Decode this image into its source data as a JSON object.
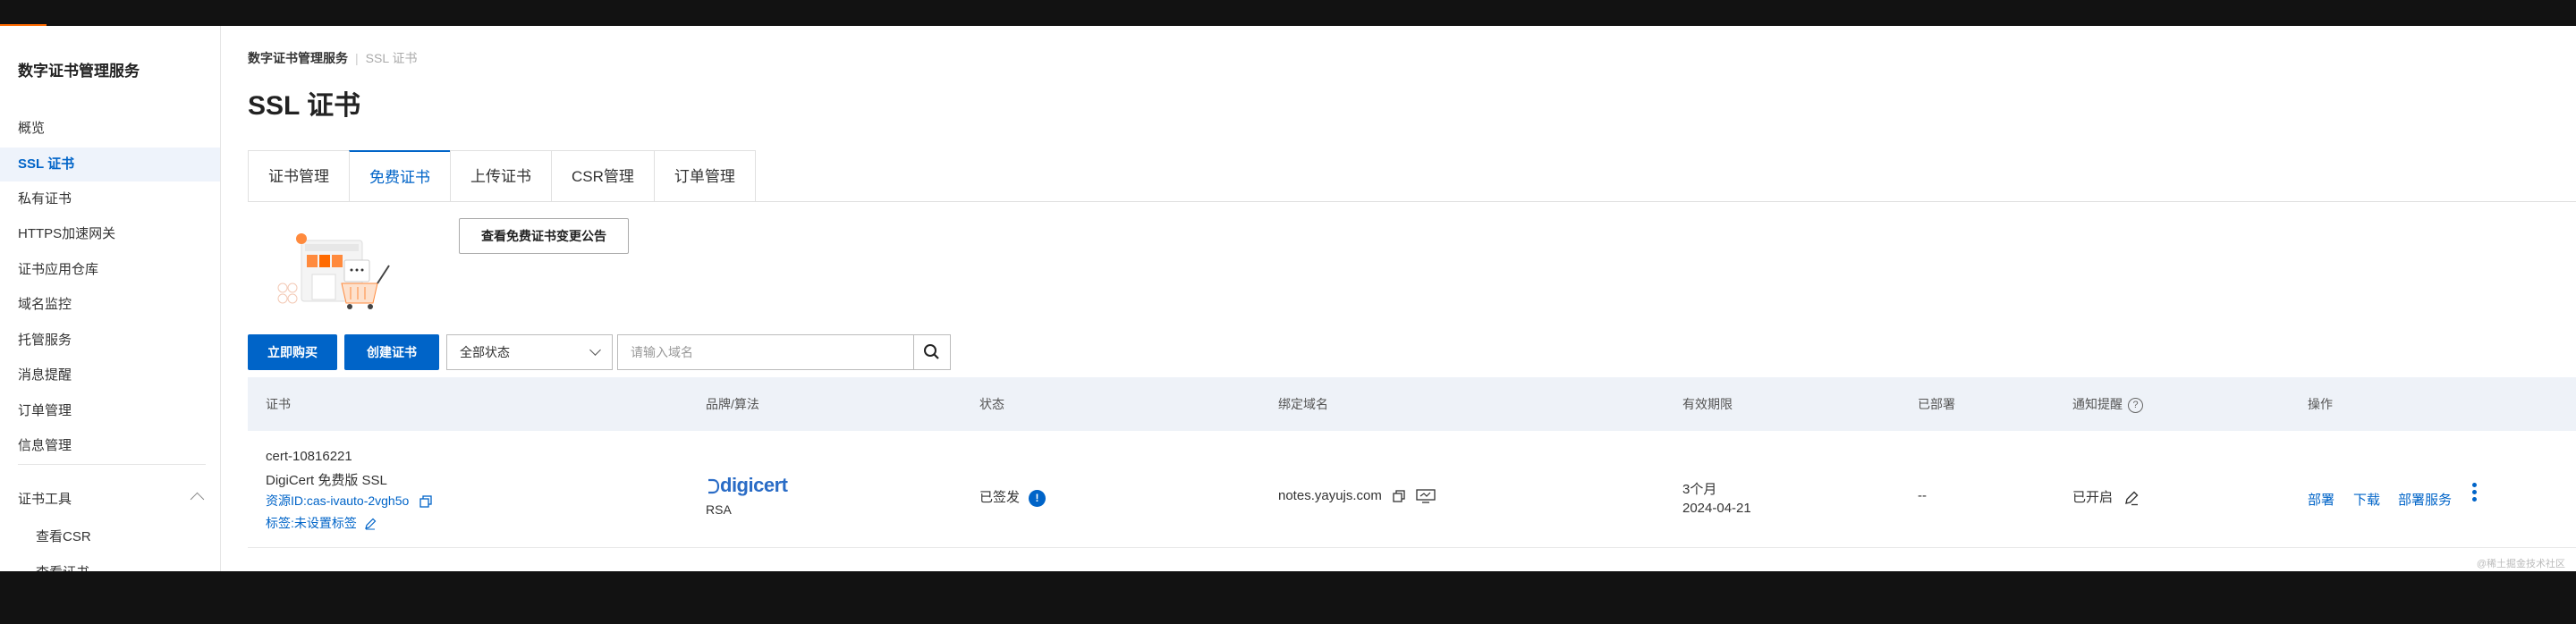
{
  "sidebar": {
    "title": "数字证书管理服务",
    "items": [
      {
        "label": "概览"
      },
      {
        "label": "SSL 证书"
      },
      {
        "label": "私有证书"
      },
      {
        "label": "HTTPS加速网关"
      },
      {
        "label": "证书应用仓库"
      },
      {
        "label": "域名监控"
      },
      {
        "label": "托管服务"
      },
      {
        "label": "消息提醒"
      },
      {
        "label": "订单管理"
      },
      {
        "label": "信息管理"
      }
    ],
    "tools_group": "证书工具",
    "tools_items": [
      {
        "label": "查看CSR"
      },
      {
        "label": "查看证书"
      }
    ]
  },
  "breadcrumb": {
    "parent": "数字证书管理服务",
    "current": "SSL 证书"
  },
  "page_title": "SSL 证书",
  "tabs": [
    {
      "label": "证书管理"
    },
    {
      "label": "免费证书"
    },
    {
      "label": "上传证书"
    },
    {
      "label": "CSR管理"
    },
    {
      "label": "订单管理"
    }
  ],
  "notice_button": "查看免费证书变更公告",
  "toolbar": {
    "buy_label": "立即购买",
    "create_label": "创建证书",
    "status_select": "全部状态",
    "search_placeholder": "请输入域名"
  },
  "table": {
    "columns": [
      "证书",
      "品牌/算法",
      "状态",
      "绑定域名",
      "有效期限",
      "已部署",
      "通知提醒",
      "操作"
    ],
    "rows": [
      {
        "cert_id": "cert-10816221",
        "cert_name": "DigiCert 免费版 SSL",
        "resource_id": "资源ID:cas-ivauto-2vgh5o",
        "tag": "标签:未设置标签",
        "brand": "digicert",
        "algorithm": "RSA",
        "status": "已签发",
        "domain": "notes.yayujs.com",
        "validity_period": "3个月",
        "validity_date": "2024-04-21",
        "deployed": "--",
        "notify": "已开启",
        "actions": [
          "部署",
          "下载",
          "部署服务"
        ]
      }
    ]
  },
  "watermark": "@稀土掘金技术社区",
  "colors": {
    "accent": "#0064c8",
    "brand_orange": "#ff6a00"
  }
}
